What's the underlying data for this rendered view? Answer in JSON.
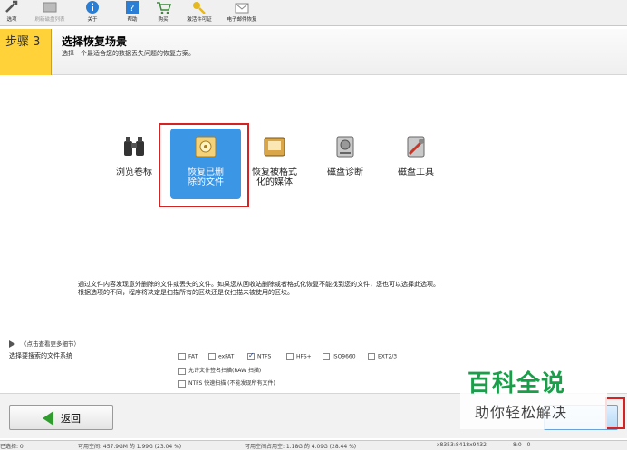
{
  "toolbar": {
    "items": [
      {
        "label": "选项",
        "icon": "wrench-icon"
      },
      {
        "label": "刷新磁盘列表",
        "icon": "disk-refresh-icon",
        "disabled": true
      },
      {
        "label": "关于",
        "icon": "info-icon"
      },
      {
        "label": "帮助",
        "icon": "help-icon"
      },
      {
        "label": "购买",
        "icon": "cart-icon"
      },
      {
        "label": "激活许可证",
        "icon": "key-icon"
      },
      {
        "label": "电子邮件恢复",
        "icon": "mail-icon"
      }
    ]
  },
  "step": {
    "badge": "步骤 3",
    "title": "选择恢复场景",
    "subtitle": "选择一个最适合您的数据丢失问题的恢复方案。"
  },
  "options": [
    {
      "label": "浏览卷标",
      "icon": "binoculars-icon",
      "selected": false
    },
    {
      "label": "恢复已删除的文件",
      "icon": "recover-deleted-icon",
      "selected": true
    },
    {
      "label": "恢复被格式化的媒体",
      "icon": "recover-format-icon",
      "selected": false
    },
    {
      "label": "磁盘诊断",
      "icon": "disk-diagnose-icon",
      "selected": false
    },
    {
      "label": "磁盘工具",
      "icon": "disk-tools-icon",
      "selected": false
    }
  ],
  "description": {
    "line1": "通过文件内容发现意外删除的文件或丢失的文件。如果您从回收站删除或者格式化恢复不能找到您的文件，您也可以选择此选项。",
    "line2": "根据选项的不同，程序将决定是扫描所有的区块还是仅扫描未被使用的区块。"
  },
  "filesystem": {
    "expand_hint": "（点击查看更多细节）",
    "label": "选择要搜索的文件系统",
    "checkboxes": [
      {
        "label": "FAT",
        "checked": false
      },
      {
        "label": "exFAT",
        "checked": false
      },
      {
        "label": "NTFS",
        "checked": true
      },
      {
        "label": "HFS+",
        "checked": false
      },
      {
        "label": "ISO9660",
        "checked": false
      },
      {
        "label": "EXT2/3",
        "checked": false
      }
    ],
    "raw_scan": "允许文件签名扫描(RAW 扫描)",
    "ntfs_fast": "NTFS 快速扫描 (不能发现所有文件)"
  },
  "nav": {
    "back": "返回"
  },
  "watermark": {
    "main": "百科全说",
    "sub": "助你轻松解决"
  },
  "status": {
    "s1": "已选择: 0",
    "s2": "可用空间: 457.9GM 的 1.99G (23.04 %)",
    "s3": "可用空间占用空: 1.18G 的 4.09G (28.44 %)",
    "s4": "x8353:8418x9432",
    "s5": "8:0 - 0"
  },
  "colors": {
    "accent": "#3c96e6",
    "step_badge": "#ffd23a",
    "highlight": "#d42323",
    "watermark": "#1a9e4a"
  }
}
